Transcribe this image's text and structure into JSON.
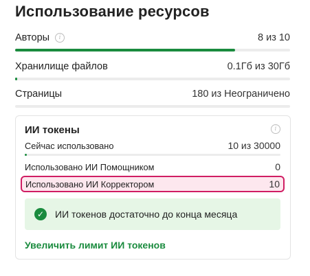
{
  "header": {
    "title": "Использование ресурсов"
  },
  "resources": [
    {
      "label": "Авторы",
      "value": "8 из 10",
      "progress": 0.8,
      "has_info": true
    },
    {
      "label": "Хранилище файлов",
      "value": "0.1Гб из 30Гб",
      "progress": 0.003
    },
    {
      "label": "Страницы",
      "value": "180 из Неограничено",
      "progress": 0
    }
  ],
  "ai_tokens": {
    "title": "ИИ токены",
    "rows": [
      {
        "label": "Сейчас использовано",
        "value": "10 из 30000",
        "progress": 0.0003
      },
      {
        "label": "Использовано ИИ Помощником",
        "value": "0"
      },
      {
        "label": "Использовано ИИ Корректором",
        "value": "10"
      }
    ],
    "notice": "ИИ токенов достаточно до конца месяца",
    "link": "Увеличить лимит ИИ токенов"
  },
  "colors": {
    "accent": "#1a8b3e",
    "highlight_border": "#d01d63",
    "highlight_bg": "#fde7ee",
    "notice_bg": "#e6f6e6"
  },
  "icons": {
    "info": "info-icon",
    "check": "check-circle-icon"
  }
}
